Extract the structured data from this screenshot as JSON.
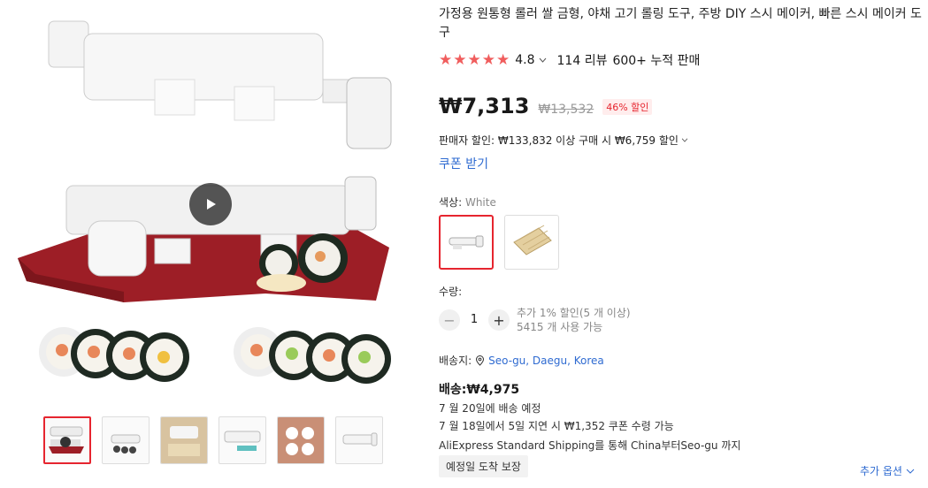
{
  "product": {
    "title": "가정용 원통형 롤러 쌀 금형, 야채 고기 롤링 도구, 주방 DIY 스시 메이커, 빠른 스시 메이커 도구",
    "rating": "4.8",
    "reviews": "114 리뷰",
    "sold": "600+ 누적 판매",
    "price": "₩7,313",
    "original_price": "₩13,532",
    "discount": "46% 할인",
    "seller_discount": "판매자 할인: ₩133,832 이상 구매 시 ₩6,759 할인",
    "coupon": "쿠폰 받기"
  },
  "color": {
    "label": "색상: ",
    "value": "White"
  },
  "quantity": {
    "label": "수량:",
    "minus": "−",
    "plus": "+",
    "value": "1",
    "info1": "추가 1% 할인(5 개 이상)",
    "info2": "5415 개 사용 가능"
  },
  "shipping": {
    "to_label": "배송지:",
    "location": "Seo-gu, Daegu, Korea",
    "fee": "배송:₩4,975",
    "line1": "7 월 20일에 배송 예정",
    "line2": "7 월 18일에서 5일 지연 시 ₩1,352 쿠폰 수령 가능",
    "line3": "AliExpress Standard Shipping를 통해 China부터Seo-gu 까지",
    "guarantee": "예정일 도착 보장",
    "more_options": "추가 옵션"
  },
  "colors": {
    "accent_red": "#e6252f",
    "star": "#f05d5d",
    "link_blue": "#2f6bd1"
  },
  "icons": [
    "play-icon",
    "star-icon",
    "chevron-down-icon",
    "location-pin-icon"
  ]
}
